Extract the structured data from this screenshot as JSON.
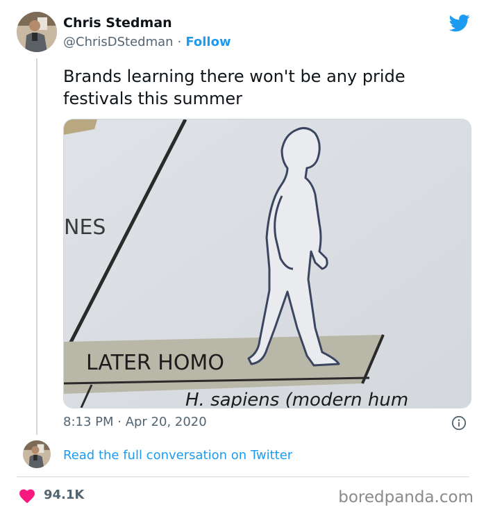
{
  "author": {
    "name": "Chris Stedman",
    "handle": "@ChrisDStedman",
    "separator": "·",
    "follow_label": "Follow"
  },
  "tweet": {
    "text": "Brands learning there won't be any pride festivals this summer",
    "time": "8:13 PM · Apr 20, 2020",
    "read_more": "Read the full conversation on Twitter",
    "likes": "94.1K"
  },
  "media": {
    "label_nes": "NES",
    "label_later_homo": "LATER HOMO",
    "label_sapiens": "H. sapiens (modern hum"
  },
  "icons": {
    "brand": "twitter-bird-icon",
    "info": "info-icon",
    "like": "heart-icon"
  },
  "colors": {
    "accent": "#1d9bf0",
    "like": "#f91880",
    "secondary_text": "#536471"
  },
  "watermark": "boredpanda.com"
}
